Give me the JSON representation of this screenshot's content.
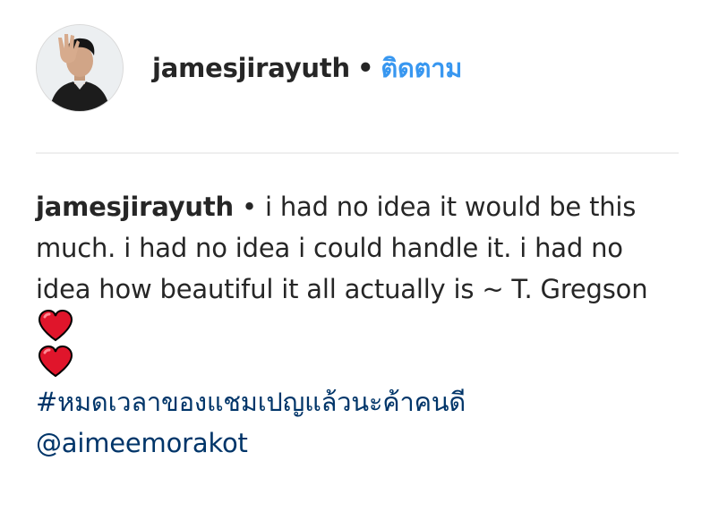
{
  "header": {
    "username": "jamesjirayuth",
    "separator": "•",
    "follow_label": "ติดตาม"
  },
  "caption": {
    "username": "jamesjirayuth",
    "separator": "•",
    "text": "i had no idea it would be this much. i had no idea i could handle it. i had no idea how beautiful it all actually is ~ T. Gregson",
    "emojis": [
      "heart-emoji",
      "heart-emoji"
    ],
    "hashtag": "#หมดเวลาของแชมเปญแล้วนะค้าคนดี",
    "mention": "@aimeemorakot"
  },
  "colors": {
    "follow": "#3897f0",
    "link": "#003569",
    "text": "#262626",
    "heart": "#e0152b"
  }
}
